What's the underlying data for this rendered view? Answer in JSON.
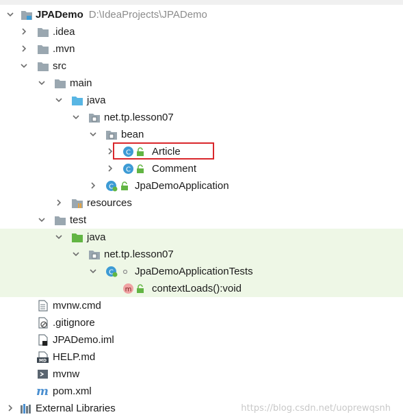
{
  "project": {
    "name": "JPADemo",
    "path": "D:\\IdeaProjects\\JPADemo"
  },
  "tree": {
    "idea": ".idea",
    "mvn": ".mvn",
    "src": "src",
    "main": "main",
    "java": "java",
    "package_main": "net.tp.lesson07",
    "bean": "bean",
    "article": "Article",
    "comment": "Comment",
    "app_class": "JpaDemoApplication",
    "resources": "resources",
    "test": "test",
    "test_java": "java",
    "package_test": "net.tp.lesson07",
    "test_class": "JpaDemoApplicationTests",
    "test_method": "contextLoads():void",
    "mvnw_cmd": "mvnw.cmd",
    "gitignore": ".gitignore",
    "iml": "JPADemo.iml",
    "help": "HELP.md",
    "mvnw": "mvnw",
    "pom": "pom.xml",
    "external_libraries": "External Libraries"
  },
  "icons": {
    "folder": "folder-icon",
    "source_folder": "source-folder-icon",
    "test_folder": "test-source-folder-icon",
    "package": "package-icon",
    "class": "class-icon",
    "spring_class": "spring-boot-class-icon",
    "method": "method-icon",
    "lock": "lock-icon",
    "file": "text-file-icon",
    "gitignore": "gitignore-file-icon",
    "iml": "iml-file-icon",
    "markdown": "markdown-file-icon",
    "shell": "shell-script-icon",
    "maven": "maven-pom-icon",
    "libraries": "external-libraries-icon"
  },
  "colors": {
    "highlight_border": "#d9262b",
    "test_background": "#eef7e6",
    "class_icon": "#3d9bd5",
    "source_folder": "#58b6e4",
    "test_folder": "#62b543",
    "path_text": "#8c8c8c"
  },
  "watermark": "https://blog.csdn.net/uoprewqsnh"
}
